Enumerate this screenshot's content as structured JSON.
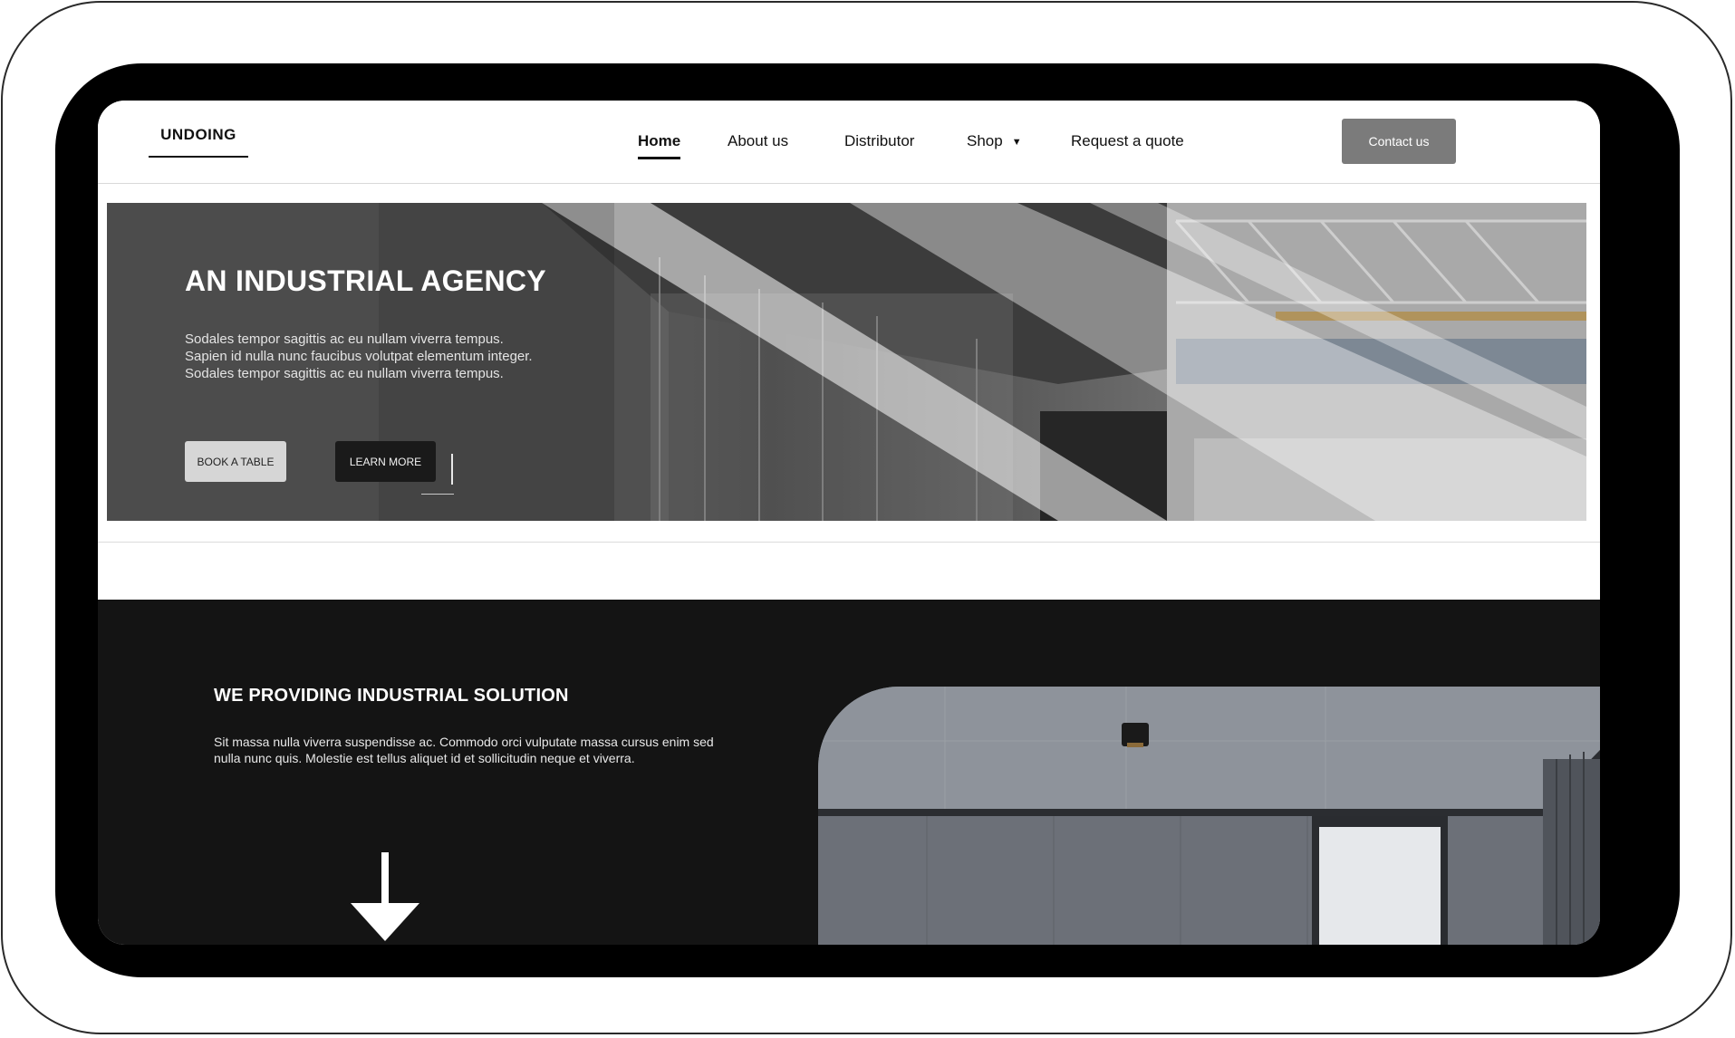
{
  "brand": {
    "logo_text": "UNDOING"
  },
  "nav": {
    "items": [
      {
        "label": "Home",
        "active": true
      },
      {
        "label": "About us",
        "active": false
      },
      {
        "label": "Distributor",
        "active": false
      },
      {
        "label": "Shop",
        "active": false,
        "has_dropdown": true
      },
      {
        "label": "Request a quote",
        "active": false
      }
    ],
    "dropdown_icon": "caret-down-icon",
    "contact_label": "Contact us"
  },
  "hero": {
    "title": "AN INDUSTRIAL AGENCY",
    "text": "Sodales tempor sagittis ac eu nullam viverra tempus. Sapien id nulla nunc faucibus volutpat elementum integer. Sodales tempor sagittis ac eu nullam viverra tempus.",
    "primary_button": "BOOK A TABLE",
    "secondary_button": "LEARN MORE"
  },
  "solution": {
    "title": "WE PROVIDING INDUSTRIAL SOLUTION",
    "text": "Sit massa nulla viverra suspendisse ac. Commodo orci vulputate massa cursus enim sed nulla nunc quis. Molestie est tellus aliquet id et sollicitudin neque et viverra.",
    "scroll_icon": "arrow-down-icon"
  },
  "colors": {
    "contact_button_bg": "#7b7b7b",
    "dark_section_bg": "#141414",
    "book_button_bg": "#d6d6d6",
    "learn_button_bg": "#1a1a1a"
  }
}
